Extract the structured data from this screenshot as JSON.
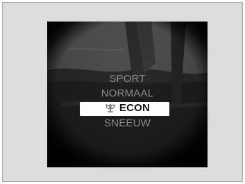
{
  "drive_mode_menu": {
    "items": [
      {
        "label": "SPORT",
        "selected": false
      },
      {
        "label": "NORMAAL",
        "selected": false
      },
      {
        "label": "ECON",
        "selected": true,
        "icon": "econ-leaf-icon"
      },
      {
        "label": "SNEEUW",
        "selected": false
      }
    ]
  },
  "colors": {
    "background": "#dcdcdc",
    "screen": "#101010",
    "inactive_text": "#8c8c8c",
    "highlight": "#ffffff",
    "active_text": "#111111"
  }
}
